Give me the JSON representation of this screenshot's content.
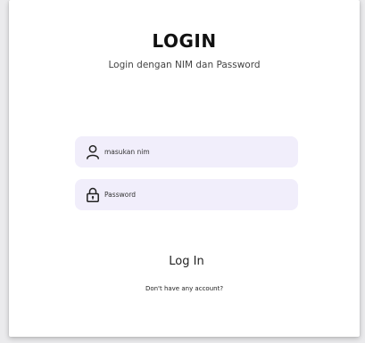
{
  "login": {
    "title": "LOGIN",
    "subtitle": "Login dengan NIM dan Password"
  },
  "fields": {
    "nim": {
      "placeholder": "masukan nim",
      "icon": "user-icon"
    },
    "password": {
      "placeholder": "Password",
      "icon": "lock-icon"
    }
  },
  "actions": {
    "login_label": "Log In",
    "account_text": "Don't have any account?"
  },
  "colors": {
    "field_background": "#f1eefb",
    "card_background": "#ffffff",
    "text": "#111111"
  }
}
